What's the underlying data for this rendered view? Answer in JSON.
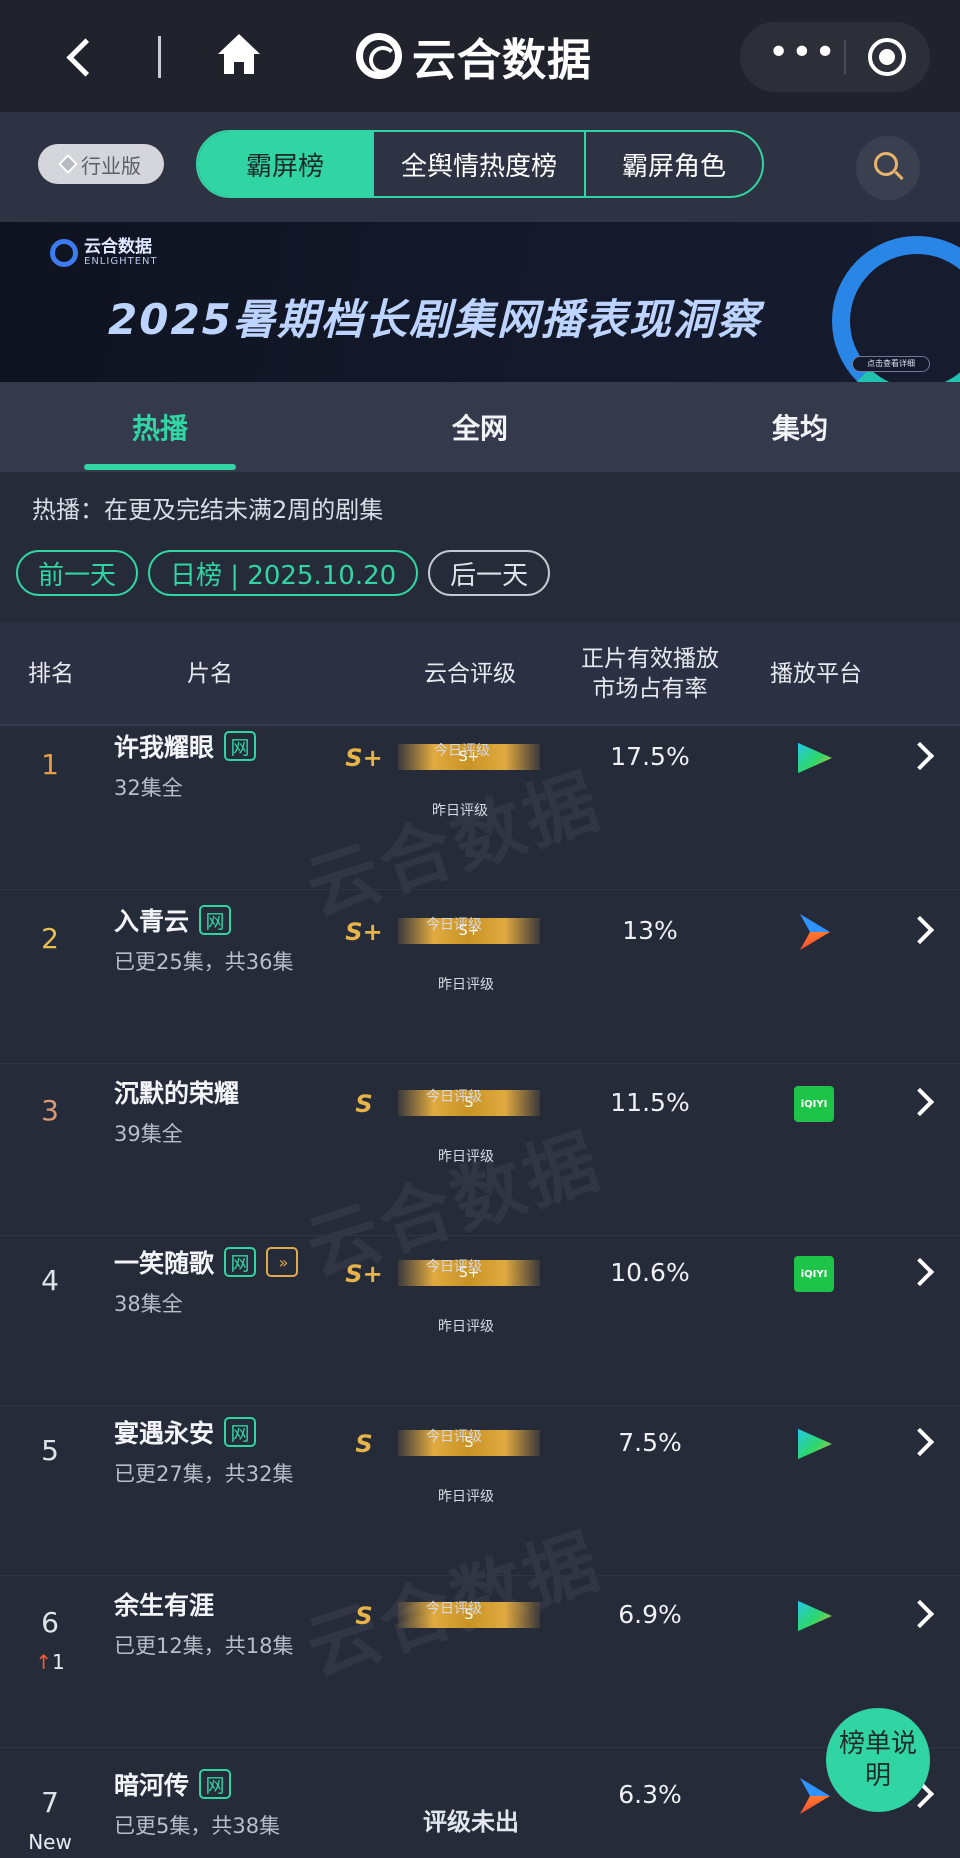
{
  "topbar": {
    "brand_name": "云合数据"
  },
  "filter": {
    "edition_label": "行业版",
    "segments": [
      "霸屏榜",
      "全舆情热度榜",
      "霸屏角色"
    ],
    "active_segment": 0
  },
  "banner": {
    "logo_cn": "云合数据",
    "logo_en": "ENLIGHTENT",
    "title": "2025暑期档长剧集网播表现洞察",
    "cta": "点击查看详细"
  },
  "tabs": [
    "热播",
    "全网",
    "集均"
  ],
  "active_tab": 0,
  "note": "热播：在更及完结未满2周的剧集",
  "date": {
    "prev": "前一天",
    "current": "日榜 | 2025.10.20",
    "next": "后一天"
  },
  "table": {
    "headers": {
      "rank": "排名",
      "title": "片名",
      "grade": "云合评级",
      "share": "正片有效播放\n市场占有率",
      "platform": "播放平台"
    },
    "today_label": "今日评级",
    "yesterday_label": "昨日评级",
    "rows": [
      {
        "rank": "1",
        "change": "",
        "title": "许我耀眼",
        "net_tag": "网",
        "ff_tag": "",
        "episodes": "32集全",
        "grade": "S+",
        "bar_grade": "S+",
        "no_grade": "",
        "share": "17.5%",
        "platform": "tencent-video-icon"
      },
      {
        "rank": "2",
        "change": "",
        "title": "入青云",
        "net_tag": "网",
        "ff_tag": "",
        "episodes": "已更25集，共36集",
        "grade": "S+",
        "bar_grade": "S+",
        "no_grade": "",
        "share": "13%",
        "platform": "youku-icon"
      },
      {
        "rank": "3",
        "change": "",
        "title": "沉默的荣耀",
        "net_tag": "",
        "ff_tag": "",
        "episodes": "39集全",
        "grade": "S",
        "bar_grade": "S",
        "no_grade": "",
        "share": "11.5%",
        "platform": "iqiyi-icon"
      },
      {
        "rank": "4",
        "change": "",
        "title": "一笑随歌",
        "net_tag": "网",
        "ff_tag": "»",
        "episodes": "38集全",
        "grade": "S+",
        "bar_grade": "S+",
        "no_grade": "",
        "share": "10.6%",
        "platform": "iqiyi-icon"
      },
      {
        "rank": "5",
        "change": "",
        "title": "宴遇永安",
        "net_tag": "网",
        "ff_tag": "",
        "episodes": "已更27集，共32集",
        "grade": "S",
        "bar_grade": "S",
        "no_grade": "",
        "share": "7.5%",
        "platform": "tencent-video-icon"
      },
      {
        "rank": "6",
        "change": "1",
        "title": "余生有涯",
        "net_tag": "",
        "ff_tag": "",
        "episodes": "已更12集，共18集",
        "grade": "S",
        "bar_grade": "S",
        "no_grade": "",
        "share": "6.9%",
        "platform": "tencent-video-icon"
      },
      {
        "rank": "7",
        "change": "New",
        "title": "暗河传",
        "net_tag": "网",
        "ff_tag": "",
        "episodes": "已更5集，共38集",
        "grade": "",
        "bar_grade": "",
        "no_grade": "评级未出",
        "share": "6.3%",
        "platform": "youku-icon"
      }
    ]
  },
  "float_button": "榜单说明",
  "watermark": "云合数据"
}
